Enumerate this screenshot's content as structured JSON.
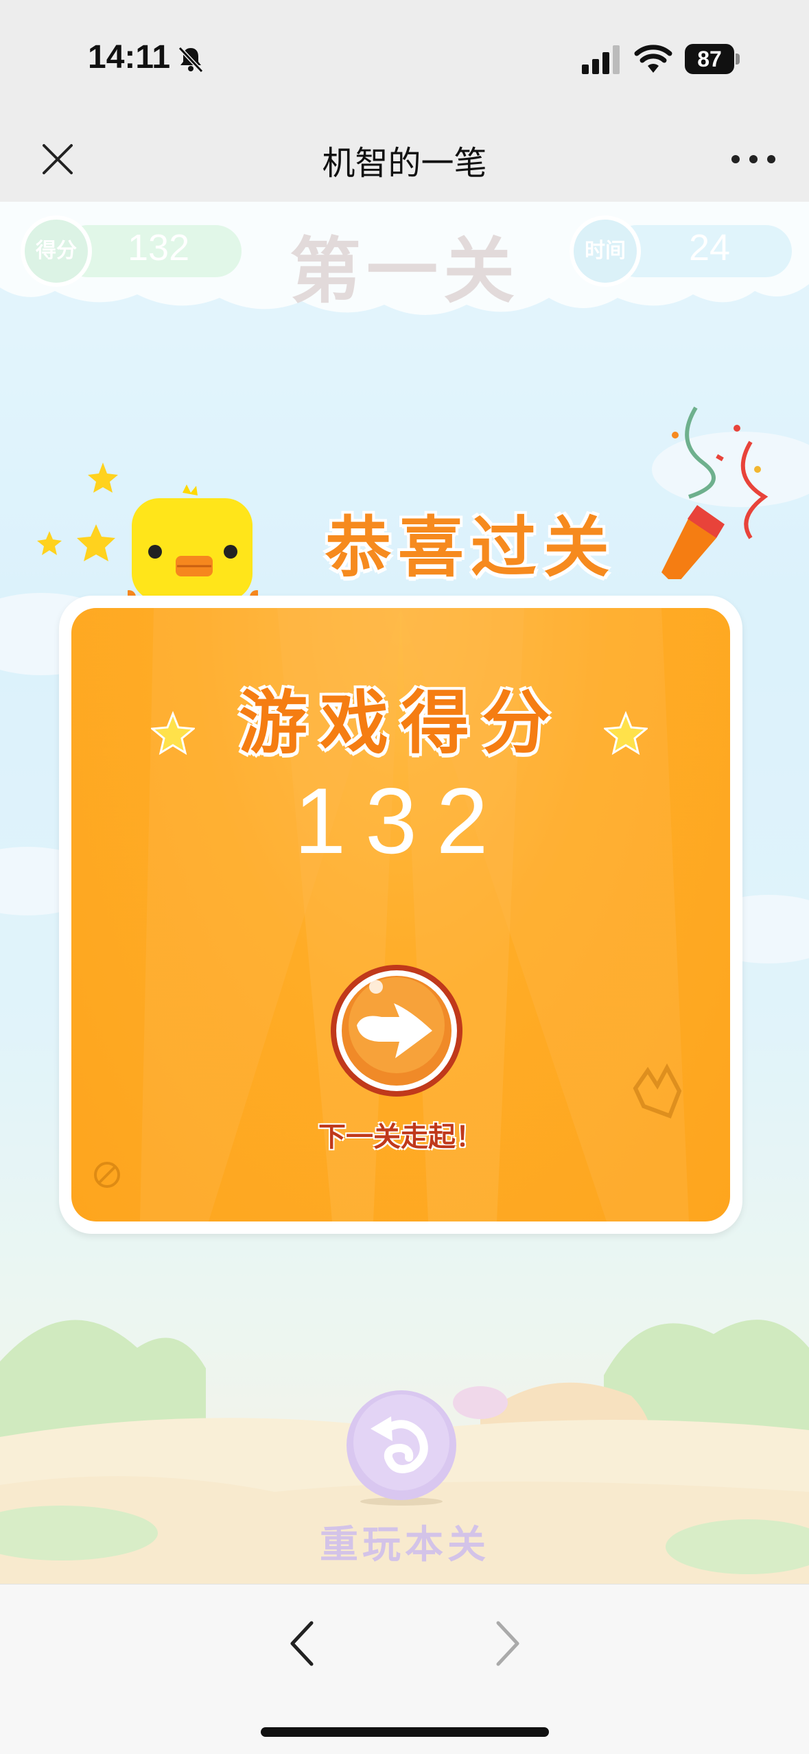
{
  "status_bar": {
    "time": "14:11",
    "battery": "87"
  },
  "nav": {
    "title": "机智的一笔"
  },
  "hud": {
    "score_label": "得分",
    "score_value": "132",
    "level_title": "第一关",
    "time_label": "时间",
    "time_value": "24"
  },
  "popup": {
    "banner": "恭喜过关",
    "heading": "游戏得分",
    "score": "132",
    "next_label": "下一关走起！"
  },
  "replay": {
    "label": "重玩本关"
  },
  "colors": {
    "accent": "#f68a1e",
    "card": "#fea51e",
    "next_button": "#f08a28",
    "replay_button": "#d9c7f0"
  },
  "icons": [
    "bell-slash-icon",
    "signal-icon",
    "wifi-icon",
    "battery-icon",
    "close-icon",
    "more-icon",
    "duck-icon",
    "confetti-icon",
    "star-icon",
    "arrow-right-icon",
    "crown-icon",
    "replay-icon",
    "chevron-left-icon",
    "chevron-right-icon"
  ]
}
